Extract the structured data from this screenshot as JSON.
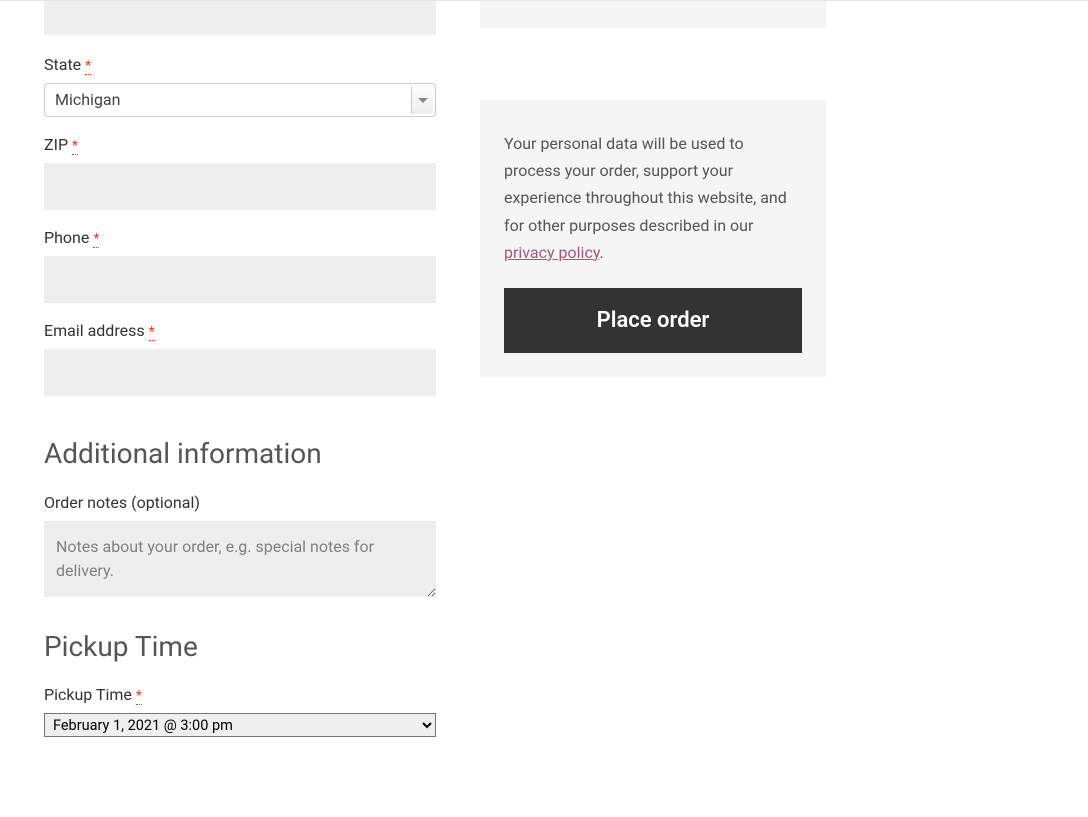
{
  "billing": {
    "state_label": "State",
    "state_value": "Michigan",
    "zip_label": "ZIP",
    "zip_value": "",
    "phone_label": "Phone",
    "phone_value": "",
    "email_label": "Email address",
    "email_value": ""
  },
  "additional": {
    "heading": "Additional information",
    "notes_label": "Order notes (optional)",
    "notes_placeholder": "Notes about your order, e.g. special notes for delivery.",
    "notes_value": ""
  },
  "pickup": {
    "heading": "Pickup Time",
    "label": "Pickup Time",
    "value": "February 1, 2021 @ 3:00 pm"
  },
  "privacy": {
    "text_before": "Your personal data will be used to process your order, support your experience throughout this website, and for other purposes described in our ",
    "link_text": "privacy policy",
    "text_after": "."
  },
  "place_order_label": "Place order",
  "required_marker": "*"
}
